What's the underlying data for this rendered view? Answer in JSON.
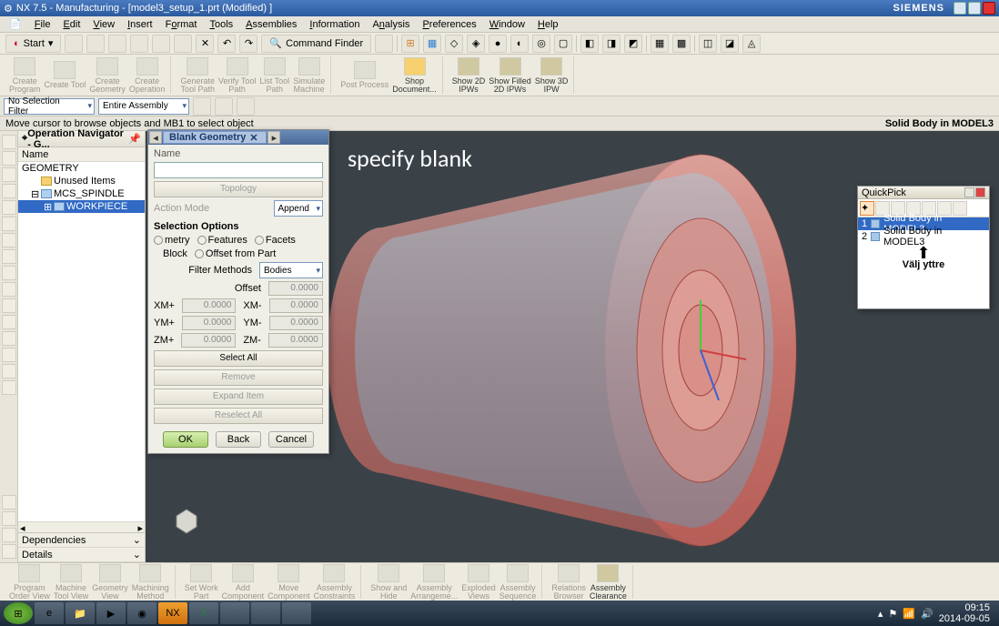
{
  "title": "NX 7.5 - Manufacturing - [model3_setup_1.prt (Modified) ]",
  "brand": "SIEMENS",
  "menu": [
    "File",
    "Edit",
    "View",
    "Insert",
    "Format",
    "Tools",
    "Assemblies",
    "Information",
    "Analysis",
    "Preferences",
    "Window",
    "Help"
  ],
  "start": "Start",
  "cmdfinder": "Command Finder",
  "ribbon_top": [
    {
      "l": "Create\nProgram"
    },
    {
      "l": "Create Tool"
    },
    {
      "l": "Create\nGeometry"
    },
    {
      "l": "Create\nOperation"
    },
    {
      "l": "Generate\nTool Path"
    },
    {
      "l": "Verify Tool\nPath"
    },
    {
      "l": "List Tool\nPath"
    },
    {
      "l": "Simulate\nMachine"
    },
    {
      "l": "Post Process"
    },
    {
      "l": "Shop\nDocument...",
      "en": true
    },
    {
      "l": "Show 2D\nIPWs",
      "en": true
    },
    {
      "l": "Show Filled\n2D IPWs",
      "en": true
    },
    {
      "l": "Show 3D\nIPW",
      "en": true
    }
  ],
  "selfilter": {
    "label": "No Selection Filter",
    "assy": "Entire Assembly"
  },
  "status_left": "Move cursor to browse objects and MB1 to select object",
  "status_right": "Solid Body in MODEL3",
  "nav": {
    "title": "Operation Navigator - G...",
    "col": "Name",
    "tree": {
      "root": "GEOMETRY",
      "unused": "Unused Items",
      "mcs": "MCS_SPINDLE",
      "wp": "WORKPIECE"
    },
    "dep": "Dependencies",
    "det": "Details"
  },
  "dialog": {
    "tab": "Blank Geometry",
    "name_lbl": "Name",
    "topology": "Topology",
    "action_mode": "Action Mode",
    "append": "Append",
    "selopt": "Selection Options",
    "r_geom": "metry",
    "r_feat": "Features",
    "r_facets": "Facets",
    "r_block": "Block",
    "r_offset": "Offset from Part",
    "filter_methods": "Filter Methods",
    "filter_val": "Bodies",
    "offset_lbl": "Offset",
    "offset_val": "0.0000",
    "xm_p": "XM+",
    "xm_m": "XM-",
    "ym_p": "YM+",
    "ym_m": "YM-",
    "zm_p": "ZM+",
    "zm_m": "ZM-",
    "zero": "0.0000",
    "selectall": "Select All",
    "remove": "Remove",
    "expand": "Expand Item",
    "reselect": "Reselect All",
    "ok": "OK",
    "back": "Back",
    "cancel": "Cancel"
  },
  "annot": "specify blank",
  "quickpick": {
    "title": "QuickPick",
    "rows": [
      {
        "n": "1",
        "t": "Solid Body in MODEL3"
      },
      {
        "n": "2",
        "t": "Solid Body in MODEL3"
      }
    ],
    "annot": "Välj yttre"
  },
  "ribbon_bottom": [
    {
      "l": "Program\nOrder View"
    },
    {
      "l": "Machine\nTool View"
    },
    {
      "l": "Geometry\nView"
    },
    {
      "l": "Machining\nMethod"
    },
    {
      "l": "Set Work\nPart"
    },
    {
      "l": "Add\nComponent"
    },
    {
      "l": "Move\nComponent"
    },
    {
      "l": "Assembly\nConstraints"
    },
    {
      "l": "Show and\nHide"
    },
    {
      "l": "Assembly\nArrangeme..."
    },
    {
      "l": "Exploded\nViews"
    },
    {
      "l": "Assembly\nSequence"
    },
    {
      "l": "Relations\nBrowser"
    },
    {
      "l": "Assembly\nClearance",
      "en": true
    }
  ],
  "clock": {
    "time": "09:15",
    "date": "2014-09-05"
  }
}
